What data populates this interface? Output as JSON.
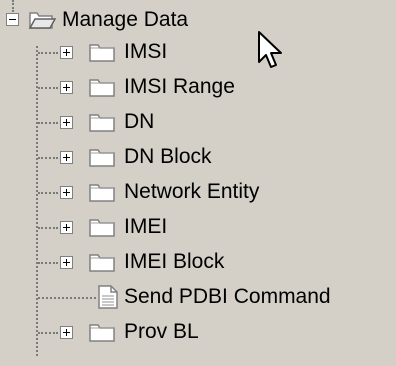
{
  "tree": {
    "root": {
      "label": "Manage Data",
      "expanded": true,
      "icon": "folder-open-icon"
    },
    "children": [
      {
        "label": "IMSI",
        "type": "folder",
        "icon": "folder-icon"
      },
      {
        "label": "IMSI Range",
        "type": "folder",
        "icon": "folder-icon"
      },
      {
        "label": "DN",
        "type": "folder",
        "icon": "folder-icon"
      },
      {
        "label": "DN Block",
        "type": "folder",
        "icon": "folder-icon"
      },
      {
        "label": "Network Entity",
        "type": "folder",
        "icon": "folder-icon"
      },
      {
        "label": "IMEI",
        "type": "folder",
        "icon": "folder-icon"
      },
      {
        "label": "IMEI Block",
        "type": "folder",
        "icon": "folder-icon"
      },
      {
        "label": "Send PDBI Command",
        "type": "document",
        "icon": "document-icon"
      },
      {
        "label": "Prov BL",
        "type": "folder",
        "icon": "folder-icon"
      }
    ]
  },
  "colors": {
    "background": "#d4d0c8",
    "folder_fill": "#ffffff",
    "folder_outline": "#808080",
    "text": "#000000"
  }
}
